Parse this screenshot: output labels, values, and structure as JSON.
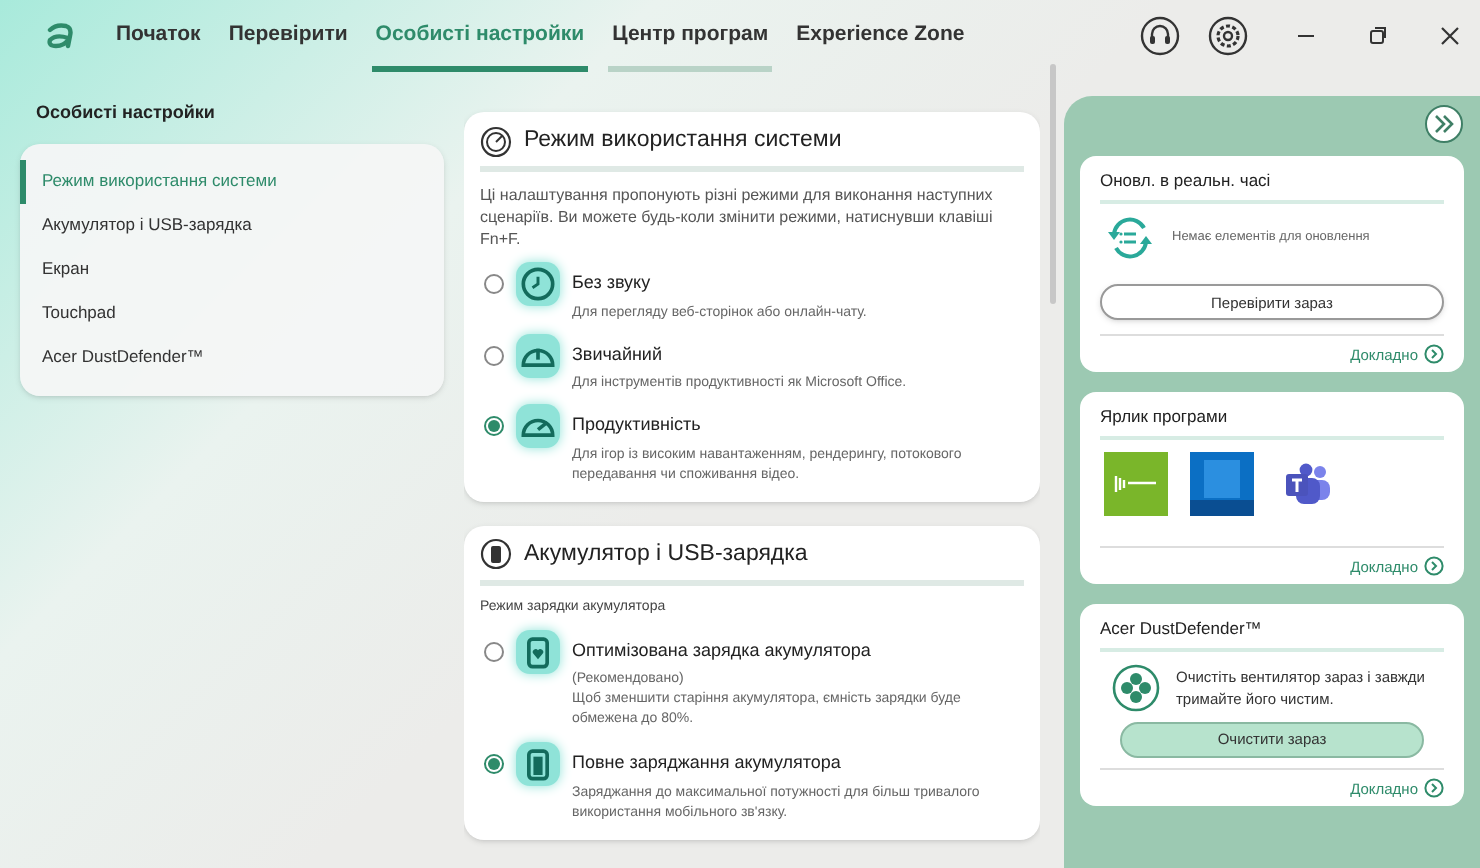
{
  "nav": {
    "tabs": [
      {
        "label": "Початок",
        "selected": false,
        "hovered": false
      },
      {
        "label": "Перевірити",
        "selected": false,
        "hovered": false
      },
      {
        "label": "Особисті настройки",
        "selected": true,
        "hovered": false
      },
      {
        "label": "Центр програм",
        "selected": false,
        "hovered": true
      },
      {
        "label": "Experience Zone",
        "selected": false,
        "hovered": false
      }
    ]
  },
  "page_title": "Особисті настройки",
  "sidebar": {
    "items": [
      {
        "label": "Режим використання системи",
        "selected": true
      },
      {
        "label": "Акумулятор і USB-зарядка",
        "selected": false
      },
      {
        "label": "Екран",
        "selected": false
      },
      {
        "label": "Touchpad",
        "selected": false
      },
      {
        "label": "Acer DustDefender™",
        "selected": false
      }
    ]
  },
  "usage_card": {
    "title": "Режим використання системи",
    "description": "Ці налаштування пропонують різні режими для виконання наступних сценаріїв. Ви можете будь-коли змінити режими, натиснувши клавіші Fn+F.",
    "options": [
      {
        "kind": "silent",
        "label": "Без звуку",
        "description": "Для перегляду веб-сторінок або онлайн-чату.",
        "selected": false
      },
      {
        "kind": "normal",
        "label": "Звичайний",
        "description": "Для інструментів продуктивності як Microsoft Office.",
        "selected": false
      },
      {
        "kind": "performance",
        "label": "Продуктивність",
        "description": "Для ігор із високим навантаженням, рендерингу, потокового передавання чи споживання відео.",
        "selected": true
      }
    ]
  },
  "battery_card": {
    "title": "Акумулятор і USB-зарядка",
    "subtitle": "Режим зарядки акумулятора",
    "options": [
      {
        "kind": "optimized",
        "label": "Оптимізована зарядка акумулятора",
        "note": "(Рекомендовано)",
        "description": "Щоб зменшити старіння акумулятора, ємність зарядки буде обмежена до 80%.",
        "selected": false
      },
      {
        "kind": "full",
        "label": "Повне заряджання акумулятора",
        "description": "Заряджання до максимальної потужності для більш тривалого використання мобільного зв'язку.",
        "selected": true
      }
    ]
  },
  "side_panel": {
    "cards": [
      {
        "kind": "updates",
        "title": "Оновл. в реальн. часі",
        "message": "Немає елементів для оновлення",
        "button": "Перевірити зараз",
        "more_link": "Докладно"
      },
      {
        "kind": "shortcuts",
        "title": "Ярлик програми",
        "more_link": "Докладно"
      },
      {
        "kind": "dust",
        "title": "Acer DustDefender™",
        "message": "Очистіть вентилятор зараз і завжди тримайте його чистим.",
        "button": "Очистити зараз",
        "more_link": "Докладно"
      }
    ]
  }
}
